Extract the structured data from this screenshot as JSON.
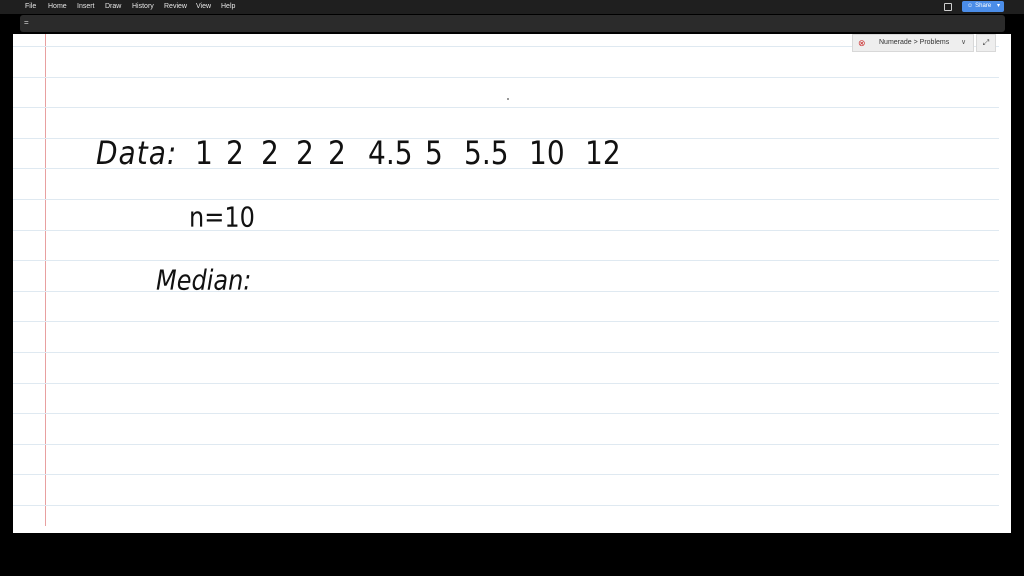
{
  "menubar": {
    "items": [
      "File",
      "Home",
      "Insert",
      "Draw",
      "History",
      "Review",
      "View",
      "Help"
    ],
    "share_label": "Share",
    "accent": "#4b8de8"
  },
  "ribbon": {
    "menu_icon": "="
  },
  "notebook": {
    "path": "Numerade > Problems",
    "expand_icon": "⤢"
  },
  "content": {
    "data_label": "Data:",
    "data_values": [
      "1",
      "2",
      "2",
      "2",
      "2",
      "4.5",
      "5",
      "5.5",
      "10",
      "12"
    ],
    "n_label": "n=10",
    "median_label": "Median:"
  }
}
